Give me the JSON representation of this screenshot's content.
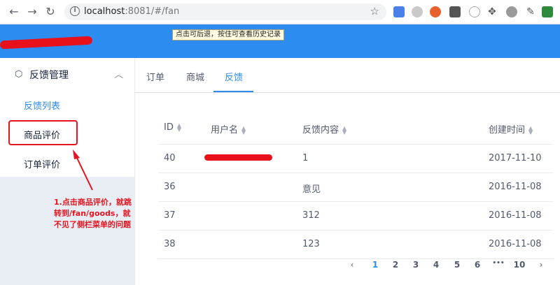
{
  "browser": {
    "url_host": "localhost",
    "url_rest": ":8081/#/fan",
    "tooltip": "点击可后退，按住可查看历史记录"
  },
  "sidebar": {
    "group_label": "反馈管理",
    "items": [
      {
        "label": "反馈列表",
        "active": true
      },
      {
        "label": "商品评价",
        "active": false
      },
      {
        "label": "订单评价",
        "active": false
      }
    ]
  },
  "annotation": {
    "line1": "1.点击商品评价，就跳",
    "line2": "转到/fan/goods，就",
    "line3": "不见了侧栏菜单的问题"
  },
  "tabs": [
    {
      "label": "订单",
      "active": false
    },
    {
      "label": "商城",
      "active": false
    },
    {
      "label": "反馈",
      "active": true
    }
  ],
  "table": {
    "headers": [
      "ID",
      "用户名",
      "反馈内容",
      "创建时间"
    ],
    "rows": [
      {
        "id": "40",
        "user": "",
        "content": "1",
        "date": "2017-11-10"
      },
      {
        "id": "36",
        "user": "",
        "content": "意见",
        "date": "2016-11-08"
      },
      {
        "id": "37",
        "user": "",
        "content": "312",
        "date": "2016-11-08"
      },
      {
        "id": "38",
        "user": "",
        "content": "123",
        "date": "2016-11-08"
      }
    ]
  },
  "pagination": {
    "prev": "‹",
    "pages": [
      "1",
      "2",
      "3",
      "4",
      "5",
      "6"
    ],
    "ellipsis": "•••",
    "last": "10",
    "next": "›",
    "current": "1"
  },
  "colors": {
    "header": "#2d8cf0",
    "accent": "#2d8cf0",
    "annotation": "#e5141e"
  }
}
